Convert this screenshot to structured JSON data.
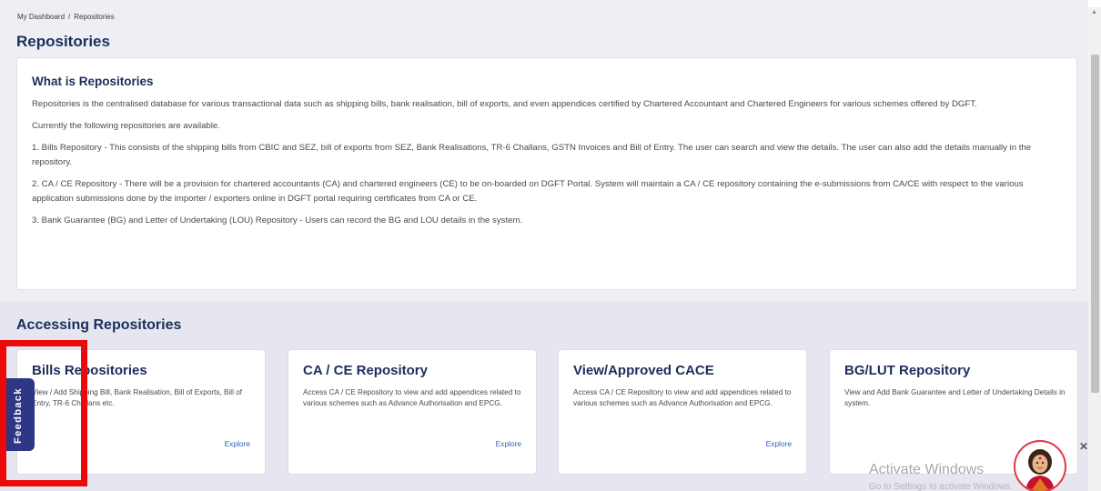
{
  "breadcrumb": {
    "items": [
      "My Dashboard",
      "/",
      "Repositories"
    ]
  },
  "page_title": "Repositories",
  "info": {
    "heading": "What is Repositories",
    "paragraphs": [
      "Repositories is the centralised database for various transactional data such as shipping bills, bank realisation, bill of exports, and even appendices certified by Chartered Accountant and Chartered Engineers for various schemes offered by DGFT.",
      "Currently the following repositories are available.",
      "1. Bills Repository - This consists of the shipping bills from CBIC and SEZ, bill of exports from SEZ, Bank Realisations, TR-6 Challans, GSTN Invoices and Bill of Entry. The user can search and view the details. The user can also add the details manually in the repository.",
      "2. CA / CE Repository - There will be a provision for chartered accountants (CA) and chartered engineers (CE) to be on-boarded on DGFT Portal. System will maintain a CA / CE repository containing the e-submissions from CA/CE with respect to the various application submissions done by the importer / exporters online in DGFT portal requiring certificates from CA or CE.",
      "3. Bank Guarantee (BG) and Letter of Undertaking (LOU) Repository - Users can record the BG and LOU details in the system."
    ]
  },
  "access": {
    "heading": "Accessing Repositories",
    "cards": [
      {
        "title": "Bills Repositories",
        "desc": "View / Add Shipping Bill, Bank Realisation, Bill of Exports, Bill of Entry, TR-6 Challans etc.",
        "explore": "Explore"
      },
      {
        "title": "CA / CE Repository",
        "desc": "Access CA / CE Repository to view and add appendices related to various schemes such as Advance Authorisation and EPCG.",
        "explore": "Explore"
      },
      {
        "title": "View/Approved CACE",
        "desc": "Access CA / CE Repository to view and add appendices related to various schemes such as Advance Authorisation and EPCG.",
        "explore": "Explore"
      },
      {
        "title": "BG/LUT Repository",
        "desc": "View and Add Bank Guarantee and Letter of Undertaking Details in system.",
        "explore": ""
      }
    ]
  },
  "feedback": {
    "label": "Feedback"
  },
  "watermark": {
    "title": "Activate Windows",
    "subtitle": "Go to Settings to activate Windows."
  },
  "close_glyph": "✕",
  "colors": {
    "heading": "#1d2e5c",
    "link": "#2f64c0",
    "feedback_tab": "#2d3785",
    "highlight": "#ea0a0a"
  },
  "icons": {
    "assistant": "assistant-avatar-icon",
    "close": "close-icon"
  }
}
